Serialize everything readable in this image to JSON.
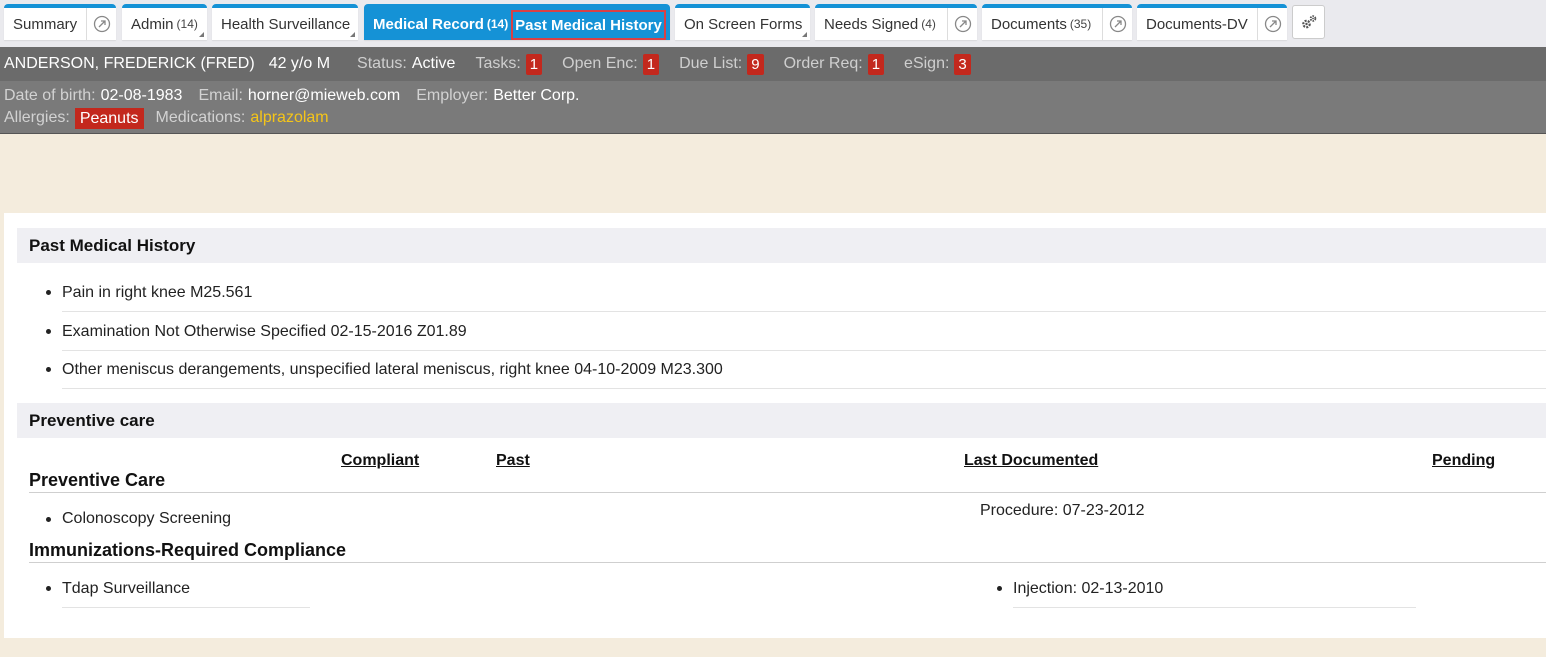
{
  "tabs": [
    {
      "label": "Summary",
      "count": "",
      "open_icon": true
    },
    {
      "label": "Admin",
      "count": "(14)",
      "caret": true
    },
    {
      "label": "Health Surveillance",
      "count": "",
      "caret": true
    },
    {
      "label": "Medical Record",
      "count": "(14)",
      "active": true
    },
    {
      "label": "On Screen Forms",
      "count": "",
      "caret": true
    },
    {
      "label": "Needs Signed",
      "count": "(4)",
      "open_icon": true
    },
    {
      "label": "Documents",
      "count": "(35)",
      "open_icon": true
    },
    {
      "label": "Documents-DV",
      "count": "",
      "open_icon": true
    }
  ],
  "active_subtab": "Past Medical History",
  "patient": {
    "name": "ANDERSON, FREDERICK (FRED)",
    "age": "42 y/o M",
    "status_label": "Status:",
    "status_value": "Active",
    "tasks_label": "Tasks:",
    "tasks": "1",
    "open_enc_label": "Open Enc:",
    "open_enc": "1",
    "due_list_label": "Due List:",
    "due_list": "9",
    "order_req_label": "Order Req:",
    "order_req": "1",
    "esign_label": "eSign:",
    "esign": "3",
    "dob_label": "Date of birth:",
    "dob": "02-08-1983",
    "email_label": "Email:",
    "email": "horner@mieweb.com",
    "employer_label": "Employer:",
    "employer": "Better Corp.",
    "allergies_label": "Allergies:",
    "allergy": "Peanuts",
    "medications_label": "Medications:",
    "medication": "alprazolam"
  },
  "past_medical_history": {
    "title": "Past Medical History",
    "items": [
      "Pain in right knee M25.561",
      "Examination Not Otherwise Specified 02-15-2016 Z01.89",
      "Other meniscus derangements, unspecified lateral meniscus, right knee 04-10-2009 M23.300"
    ]
  },
  "preventive": {
    "title": "Preventive care",
    "columns": {
      "compliant": "Compliant",
      "past": "Past",
      "last_documented": "Last Documented",
      "pending": "Pending"
    },
    "groups": [
      {
        "title": "Preventive Care",
        "item": "Colonoscopy Screening",
        "last_documented": "Procedure: 07-23-2012"
      },
      {
        "title": "Immunizations-Required Compliance",
        "item": "Tdap Surveillance",
        "last_documented": "Injection: 02-13-2010"
      }
    ]
  },
  "colors": {
    "accent": "#1592d6",
    "badge": "#c3281d",
    "medication": "#f5c518",
    "banner": "#6b6b6b"
  }
}
